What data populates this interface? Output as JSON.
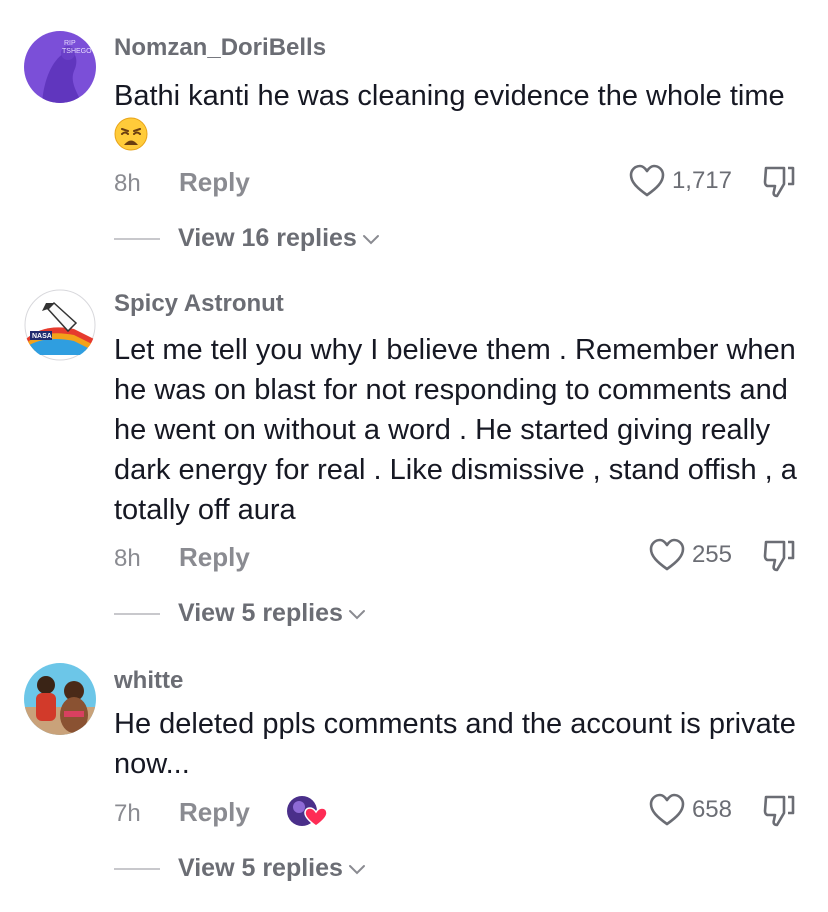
{
  "comments": [
    {
      "username": "Nomzan_DoriBells",
      "text": "Bathi kanti he was cleaning evidence the whole time",
      "emoji_icon": "weary-face-emoji",
      "time": "8h",
      "reply_label": "Reply",
      "likes": "1,717",
      "view_replies": "View 16 replies",
      "avatar_text_lines": [
        "RIP",
        "TSHEGO"
      ]
    },
    {
      "username": "Spicy Astronut",
      "text": "Let me tell you why I believe them . Remember when he was on blast for not responding to comments and he went on without a word . He started giving really dark energy for real . Like dismissive , stand offish , a totally off aura",
      "time": "8h",
      "reply_label": "Reply",
      "likes": "255",
      "view_replies": "View 5 replies",
      "avatar_logo_text": "NASA"
    },
    {
      "username": "whitte",
      "text": "He deleted ppls comments and the account is private now...",
      "time": "7h",
      "reply_label": "Reply",
      "likes": "658",
      "view_replies": "View 5 replies",
      "creator_liked_icon": "creator-liked-heart-icon"
    }
  ],
  "colors": {
    "primary_text": "#161823",
    "secondary_text": "#8a8b91",
    "heart_red": "#fe2c55"
  }
}
